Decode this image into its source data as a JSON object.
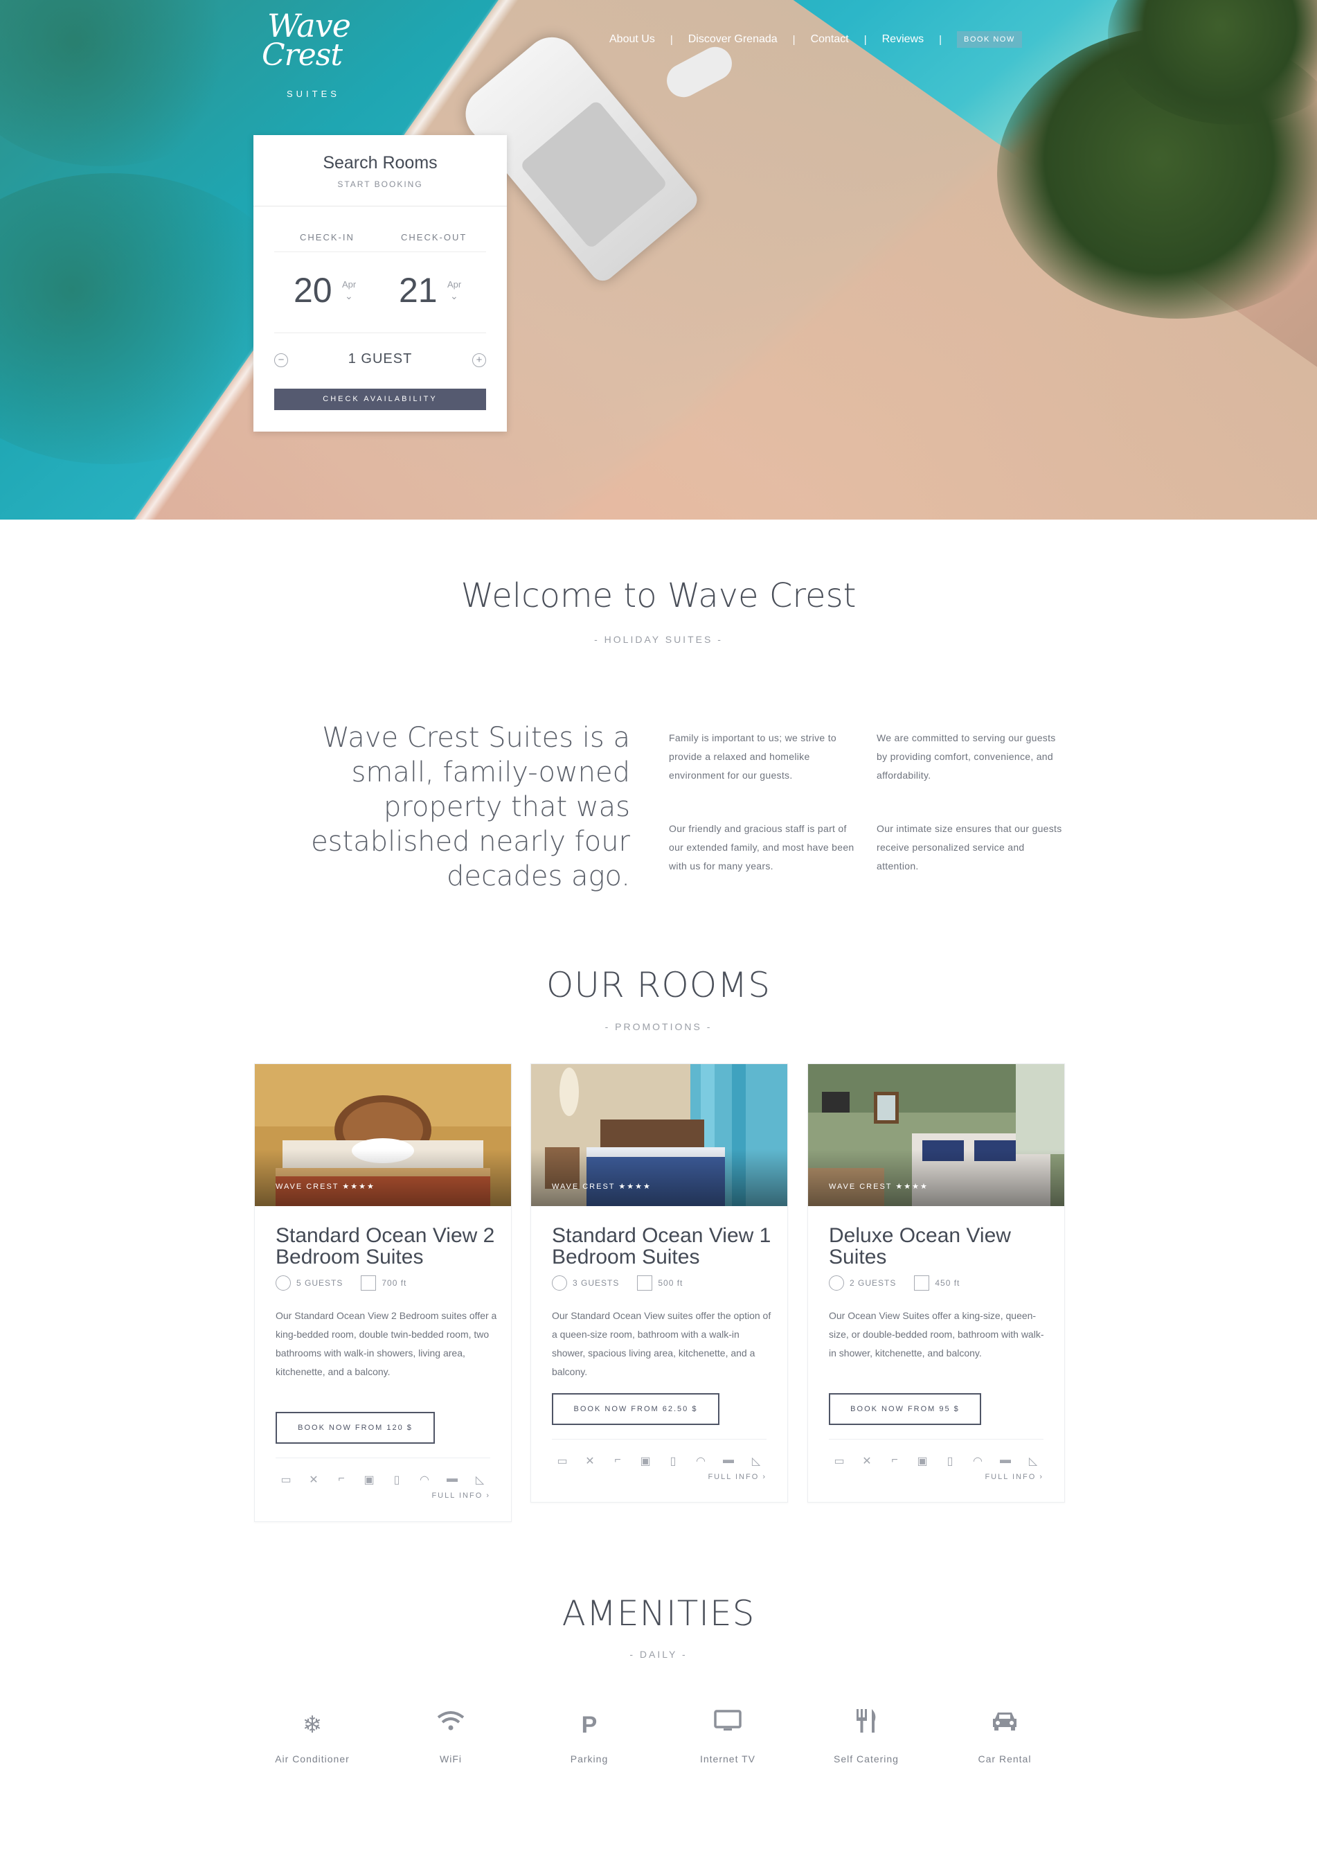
{
  "brand": {
    "logo_line1": "Wave",
    "logo_line2": "Crest",
    "logo_suites": "SUITES"
  },
  "nav": {
    "items": [
      "About Us",
      "Discover Grenada",
      "Contact",
      "Reviews"
    ],
    "separator": "|",
    "book_label": "BOOK NOW"
  },
  "search": {
    "title": "Search Rooms",
    "subtitle": "START BOOKING",
    "checkin_label": "CHECK-IN",
    "checkout_label": "CHECK-OUT",
    "checkin_day": "20",
    "checkin_month": "Apr",
    "checkout_day": "21",
    "checkout_month": "Apr",
    "guests": "1 GUEST",
    "minus": "−",
    "plus": "+",
    "button": "CHECK AVAILABILITY"
  },
  "welcome": {
    "title": "Welcome to Wave Crest",
    "subtitle": "- HOLIDAY SUITES -",
    "lead": "Wave Crest Suites is a small, family-owned property that was established nearly four decades ago.",
    "paragraphs": [
      "Family is important to us; we strive to provide a relaxed and homelike environment for our guests.",
      "We are committed to serving our guests by providing comfort, convenience, and affordability.",
      "Our friendly and gracious staff is part of our extended family, and most have been with us for many years.",
      "Our intimate size ensures that our guests receive personalized service and attention."
    ]
  },
  "rooms": {
    "title": "OUR ROOMS",
    "subtitle": "- PROMOTIONS -",
    "cards": [
      {
        "tag": "WAVE CREST ★★★★",
        "title": "Standard Ocean View 2 Bedroom Suites",
        "guests": "5 GUESTS",
        "size": "700 ft",
        "description": "Our Standard Ocean View 2 Bedroom suites offer a king-bedded room, double twin-bedded room, two bathrooms with walk-in showers, living area, kitchenette, and a balcony.",
        "cta": "BOOK NOW FROM 120 $",
        "full_info": "FULL INFO ›"
      },
      {
        "tag": "WAVE CREST ★★★★",
        "title": "Standard Ocean View 1 Bedroom Suites",
        "guests": "3 GUESTS",
        "size": "500 ft",
        "description": "Our Standard Ocean View suites offer the option of a queen-size room, bathroom with a walk-in shower, spacious living area, kitchenette, and a balcony.",
        "cta": "BOOK NOW FROM 62.50 $",
        "full_info": "FULL INFO ›"
      },
      {
        "tag": "WAVE CREST ★★★★",
        "title": "Deluxe Ocean View Suites",
        "guests": "2 GUESTS",
        "size": "450 ft",
        "description": "Our Ocean View Suites offer a king-size, queen-size, or double-bedded room, bathroom with walk-in shower, kitchenette, and balcony.",
        "cta": "BOOK NOW FROM 95 $",
        "full_info": "FULL INFO ›"
      }
    ],
    "feature_icons": [
      "tv-icon",
      "fan-icon",
      "hairdryer-icon",
      "microwave-icon",
      "fridge-icon",
      "wifi-icon",
      "air-conditioner-icon",
      "iron-icon"
    ]
  },
  "amenities": {
    "title": "AMENITIES",
    "subtitle": "- DAILY -",
    "items": [
      {
        "label": "Air Conditioner",
        "icon": "snowflake-icon"
      },
      {
        "label": "WiFi",
        "icon": "wifi-icon"
      },
      {
        "label": "Parking",
        "icon": "parking-icon"
      },
      {
        "label": "Internet TV",
        "icon": "tv-icon"
      },
      {
        "label": "Self Catering",
        "icon": "cutlery-icon"
      },
      {
        "label": "Car Rental",
        "icon": "car-icon"
      }
    ]
  },
  "colors": {
    "accent": "#67b6c6",
    "button_dark": "#555a70",
    "text": "#4a4f59"
  }
}
